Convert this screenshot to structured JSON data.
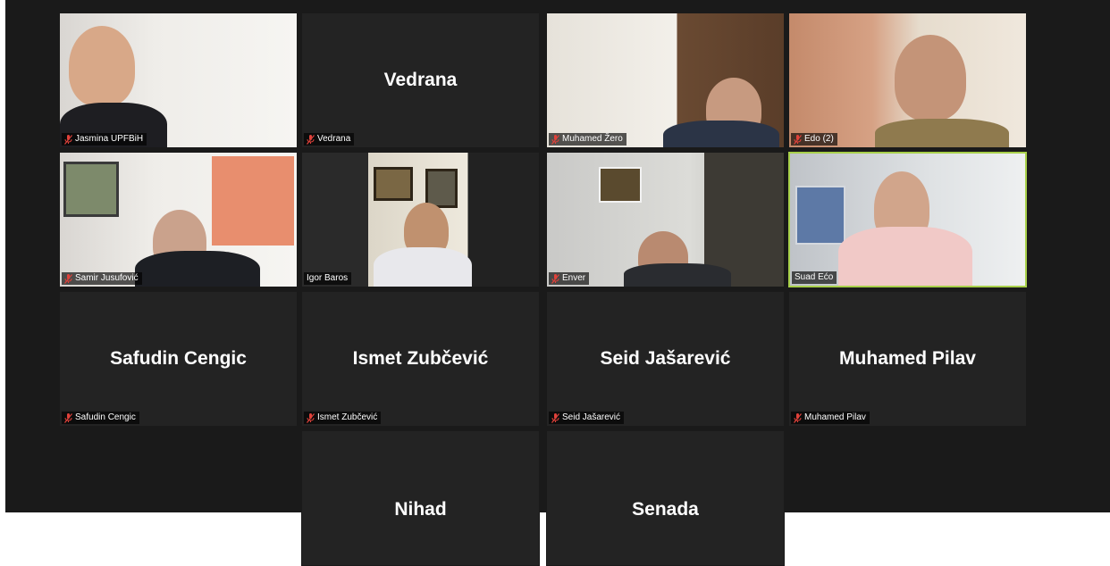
{
  "participants": [
    {
      "name": "Jasmina UPFBiH",
      "display_name": "",
      "muted": true,
      "video": true
    },
    {
      "name": "Vedrana",
      "display_name": "Vedrana",
      "muted": true,
      "video": false
    },
    {
      "name": "Muhamed Žero",
      "display_name": "",
      "muted": true,
      "video": true
    },
    {
      "name": "Edo (2)",
      "display_name": "",
      "muted": true,
      "video": true
    },
    {
      "name": "Samir Jusufović",
      "display_name": "",
      "muted": true,
      "video": true
    },
    {
      "name": "Igor Baros",
      "display_name": "",
      "muted": false,
      "video": true
    },
    {
      "name": "Enver",
      "display_name": "",
      "muted": true,
      "video": true
    },
    {
      "name": "Suad Ećo",
      "display_name": "",
      "muted": false,
      "video": true,
      "active_speaker": true
    },
    {
      "name": "Safudin Cengic",
      "display_name": "Safudin Cengic",
      "muted": true,
      "video": false
    },
    {
      "name": "Ismet Zubčević",
      "display_name": "Ismet Zubčević",
      "muted": true,
      "video": false
    },
    {
      "name": "Seid Jašarević",
      "display_name": "Seid Jašarević",
      "muted": true,
      "video": false
    },
    {
      "name": "Muhamed Pilav",
      "display_name": "Muhamed Pilav",
      "muted": true,
      "video": false
    },
    {
      "name": "",
      "display_name": "Nihad",
      "muted": false,
      "video": false
    },
    {
      "name": "",
      "display_name": "Senada",
      "muted": false,
      "video": false
    }
  ],
  "colors": {
    "background": "#1a1a1a",
    "tile": "#232323",
    "active_speaker_border": "#a8d04a",
    "muted_icon": "#e0413a"
  },
  "icons": {
    "muted": "mic-muted-icon"
  }
}
